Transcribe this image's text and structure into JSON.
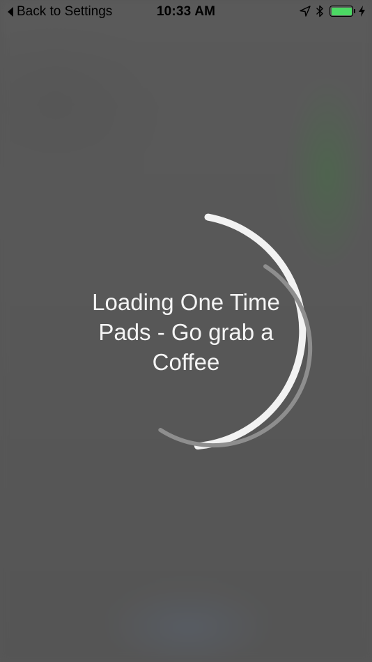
{
  "status_bar": {
    "back_label": "Back to Settings",
    "time": "10:33 AM",
    "icons": [
      "location-arrow-icon",
      "bluetooth-icon",
      "battery-icon",
      "charging-bolt-icon"
    ],
    "battery_level": 1.0,
    "battery_color": "#4cd964"
  },
  "loader": {
    "text": "Loading One Time Pads - Go grab a Coffee",
    "outer_ring_color": "#f2f2f2",
    "inner_ring_color": "#8e8e8e"
  }
}
